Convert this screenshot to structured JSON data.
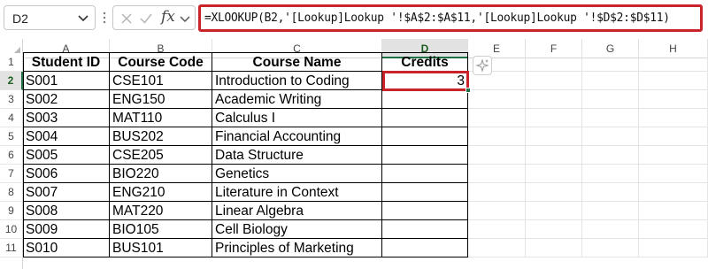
{
  "name_box": {
    "value": "D2"
  },
  "formula_bar": {
    "fx_label": "fx",
    "formula": "=XLOOKUP(B2,'[Lookup]Lookup '!$A$2:$A$11,'[Lookup]Lookup '!$D$2:$D$11)"
  },
  "columns": [
    "A",
    "B",
    "C",
    "D",
    "E",
    "F",
    "G",
    "H"
  ],
  "rows": [
    "1",
    "2",
    "3",
    "4",
    "5",
    "6",
    "7",
    "8",
    "9",
    "10",
    "11"
  ],
  "table": {
    "headers": [
      "Student ID",
      "Course Code",
      "Course Name",
      "Credits"
    ],
    "data": [
      [
        "S001",
        "CSE101",
        "Introduction to Coding",
        "3"
      ],
      [
        "S002",
        "ENG150",
        "Academic Writing",
        ""
      ],
      [
        "S003",
        "MAT110",
        "Calculus I",
        ""
      ],
      [
        "S004",
        "BUS202",
        "Financial Accounting",
        ""
      ],
      [
        "S005",
        "CSE205",
        "Data Structure",
        ""
      ],
      [
        "S006",
        "BIO220",
        "Genetics",
        ""
      ],
      [
        "S007",
        "ENG210",
        "Literature in Context",
        ""
      ],
      [
        "S008",
        "MAT220",
        "Linear Algebra",
        ""
      ],
      [
        "S009",
        "BIO105",
        "Cell Biology",
        ""
      ],
      [
        "S010",
        "BUS101",
        "Principles of Marketing",
        ""
      ]
    ]
  },
  "selection": {
    "active_cell": "D2",
    "active_column": "D",
    "active_row": "2"
  },
  "colors": {
    "highlight": "#c8242a",
    "selection_green": "#1e7145"
  },
  "icons": [
    "chevron-down-icon",
    "cancel-x-icon",
    "enter-check-icon",
    "copilot-sparkle-icon"
  ]
}
